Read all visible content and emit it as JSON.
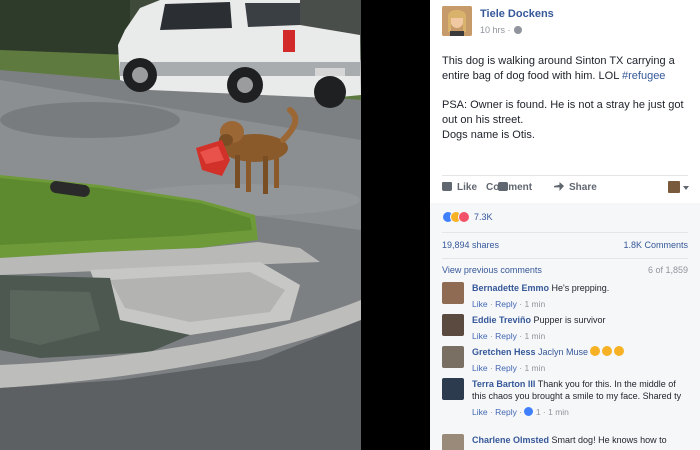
{
  "post": {
    "author": "Tiele Dockens",
    "timestamp": "10 hrs",
    "text_main": "This dog is walking around Sinton TX carrying a entire bag of dog food with him. LOL",
    "hashtag": "#refugee",
    "text_psa": "PSA: Owner is found. He is not a stray he just got out on his street.",
    "text_name": "Dogs name is Otis."
  },
  "actions": {
    "like": "Like",
    "comment": "Comment",
    "share": "Share"
  },
  "icons": {
    "globe": "globe-icon",
    "like": "thumbs-up-icon",
    "comment": "speech-bubble-icon",
    "share": "share-arrow-icon",
    "post_as_caret": "chevron-down-icon"
  },
  "stats": {
    "reaction_count": "7.3K",
    "shares": "19,894 shares",
    "comments": "1.8K Comments"
  },
  "comments_nav": {
    "view_previous": "View previous comments",
    "page_of": "6 of 1,859"
  },
  "comments": [
    {
      "name": "Bernadette Emmo",
      "text": "He's prepping.",
      "like": "Like",
      "reply": "Reply",
      "time": "1 min"
    },
    {
      "name": "Eddie Treviño",
      "text": "Pupper is survivor",
      "like": "Like",
      "reply": "Reply",
      "time": "1 min"
    },
    {
      "name": "Gretchen Hess",
      "mention": "Jaclyn Muse",
      "text": "",
      "like": "Like",
      "reply": "Reply",
      "time": "1 min"
    },
    {
      "name": "Terra Barton III",
      "text": "Thank you for this. In the middle of this chaos you brought a smile to my face. Shared ty",
      "like": "Like",
      "reply": "Reply",
      "reactions": "1",
      "time": "1 min"
    },
    {
      "name": "Charlene Olmsted",
      "text": "Smart dog! He knows how to"
    }
  ],
  "colors": {
    "link_blue": "#365899",
    "facebook_blue": "#4267b2",
    "meta_gray": "#90949c",
    "comments_bg": "#f6f7f9",
    "like_reaction": "#4080ff",
    "haha_reaction": "#f7b125",
    "love_reaction": "#f25268"
  }
}
